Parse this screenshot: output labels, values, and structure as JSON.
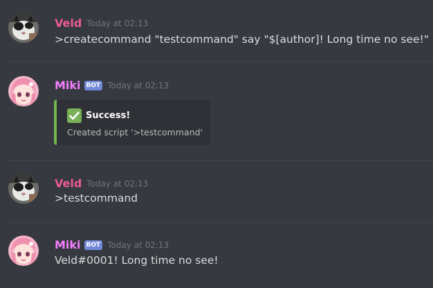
{
  "messages": [
    {
      "username": "Veld",
      "username_color": "#ec5d8f",
      "timestamp": "Today at 02:13",
      "content": ">createcommand \"testcommand\" say \"$[author]! Long time no see!\""
    },
    {
      "username": "Miki",
      "username_color": "#f47fff",
      "bot_tag": "BOT",
      "timestamp": "Today at 02:13",
      "embed": {
        "accent_color": "#74b54d",
        "icon": "white-check-mark-icon",
        "title": "Success!",
        "description": "Created script '>testcommand'"
      }
    },
    {
      "username": "Veld",
      "username_color": "#ec5d8f",
      "timestamp": "Today at 02:13",
      "content": ">testcommand"
    },
    {
      "username": "Miki",
      "username_color": "#f47fff",
      "bot_tag": "BOT",
      "timestamp": "Today at 02:13",
      "content": "Veld#0001! Long time no see!"
    }
  ],
  "colors": {
    "background": "#36393f",
    "embed_background": "#2f3136",
    "bot_tag": "#7289da",
    "timestamp": "#72767d",
    "text": "#dcddde"
  }
}
